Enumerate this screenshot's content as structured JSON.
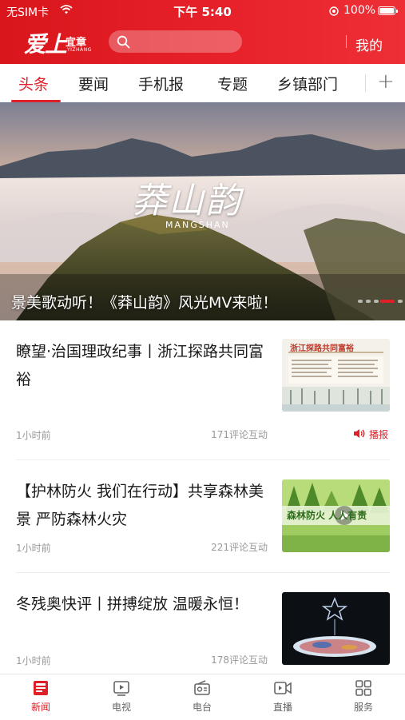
{
  "status_bar": {
    "carrier": "无SIM卡",
    "time": "下午 5:40",
    "battery": "100%"
  },
  "header": {
    "logo_main": "爱上",
    "logo_sub": "宜章",
    "logo_latin": "YIZHANG",
    "search_placeholder": "",
    "mine_label": "我的",
    "brand_color": "#e02028"
  },
  "tabs": {
    "items": [
      {
        "label": "头条",
        "active": true
      },
      {
        "label": "要闻"
      },
      {
        "label": "手机报"
      },
      {
        "label": "专题"
      },
      {
        "label": "乡镇部门"
      }
    ],
    "add_icon": "plus-icon"
  },
  "hero": {
    "art_title": "莽山韵",
    "art_latin": "MANGSHAN",
    "caption": "景美歌动听！《莽山韵》风光MV来啦！",
    "slide_count": 5,
    "active_slide": 4
  },
  "news": [
    {
      "title": "瞭望·治国理政纪事丨浙江探路共同富裕",
      "time": "1小时前",
      "comments": "171评论互动",
      "broadcast": "播报",
      "thumb_text": "浙江探路共同富裕"
    },
    {
      "title": "【护林防火 我们在行动】共享森林美景 严防森林火灾",
      "time": "1小时前",
      "comments": "221评论互动",
      "thumb_text": "森林防火 人人有责"
    },
    {
      "title": "冬残奥快评丨拼搏绽放 温暖永恒！",
      "time": "1小时前",
      "comments": "178评论互动"
    }
  ],
  "bottom_nav": [
    {
      "label": "新闻",
      "icon": "news-icon",
      "active": true
    },
    {
      "label": "电视",
      "icon": "tv-icon"
    },
    {
      "label": "电台",
      "icon": "radio-icon"
    },
    {
      "label": "直播",
      "icon": "live-icon"
    },
    {
      "label": "服务",
      "icon": "grid-icon"
    }
  ]
}
